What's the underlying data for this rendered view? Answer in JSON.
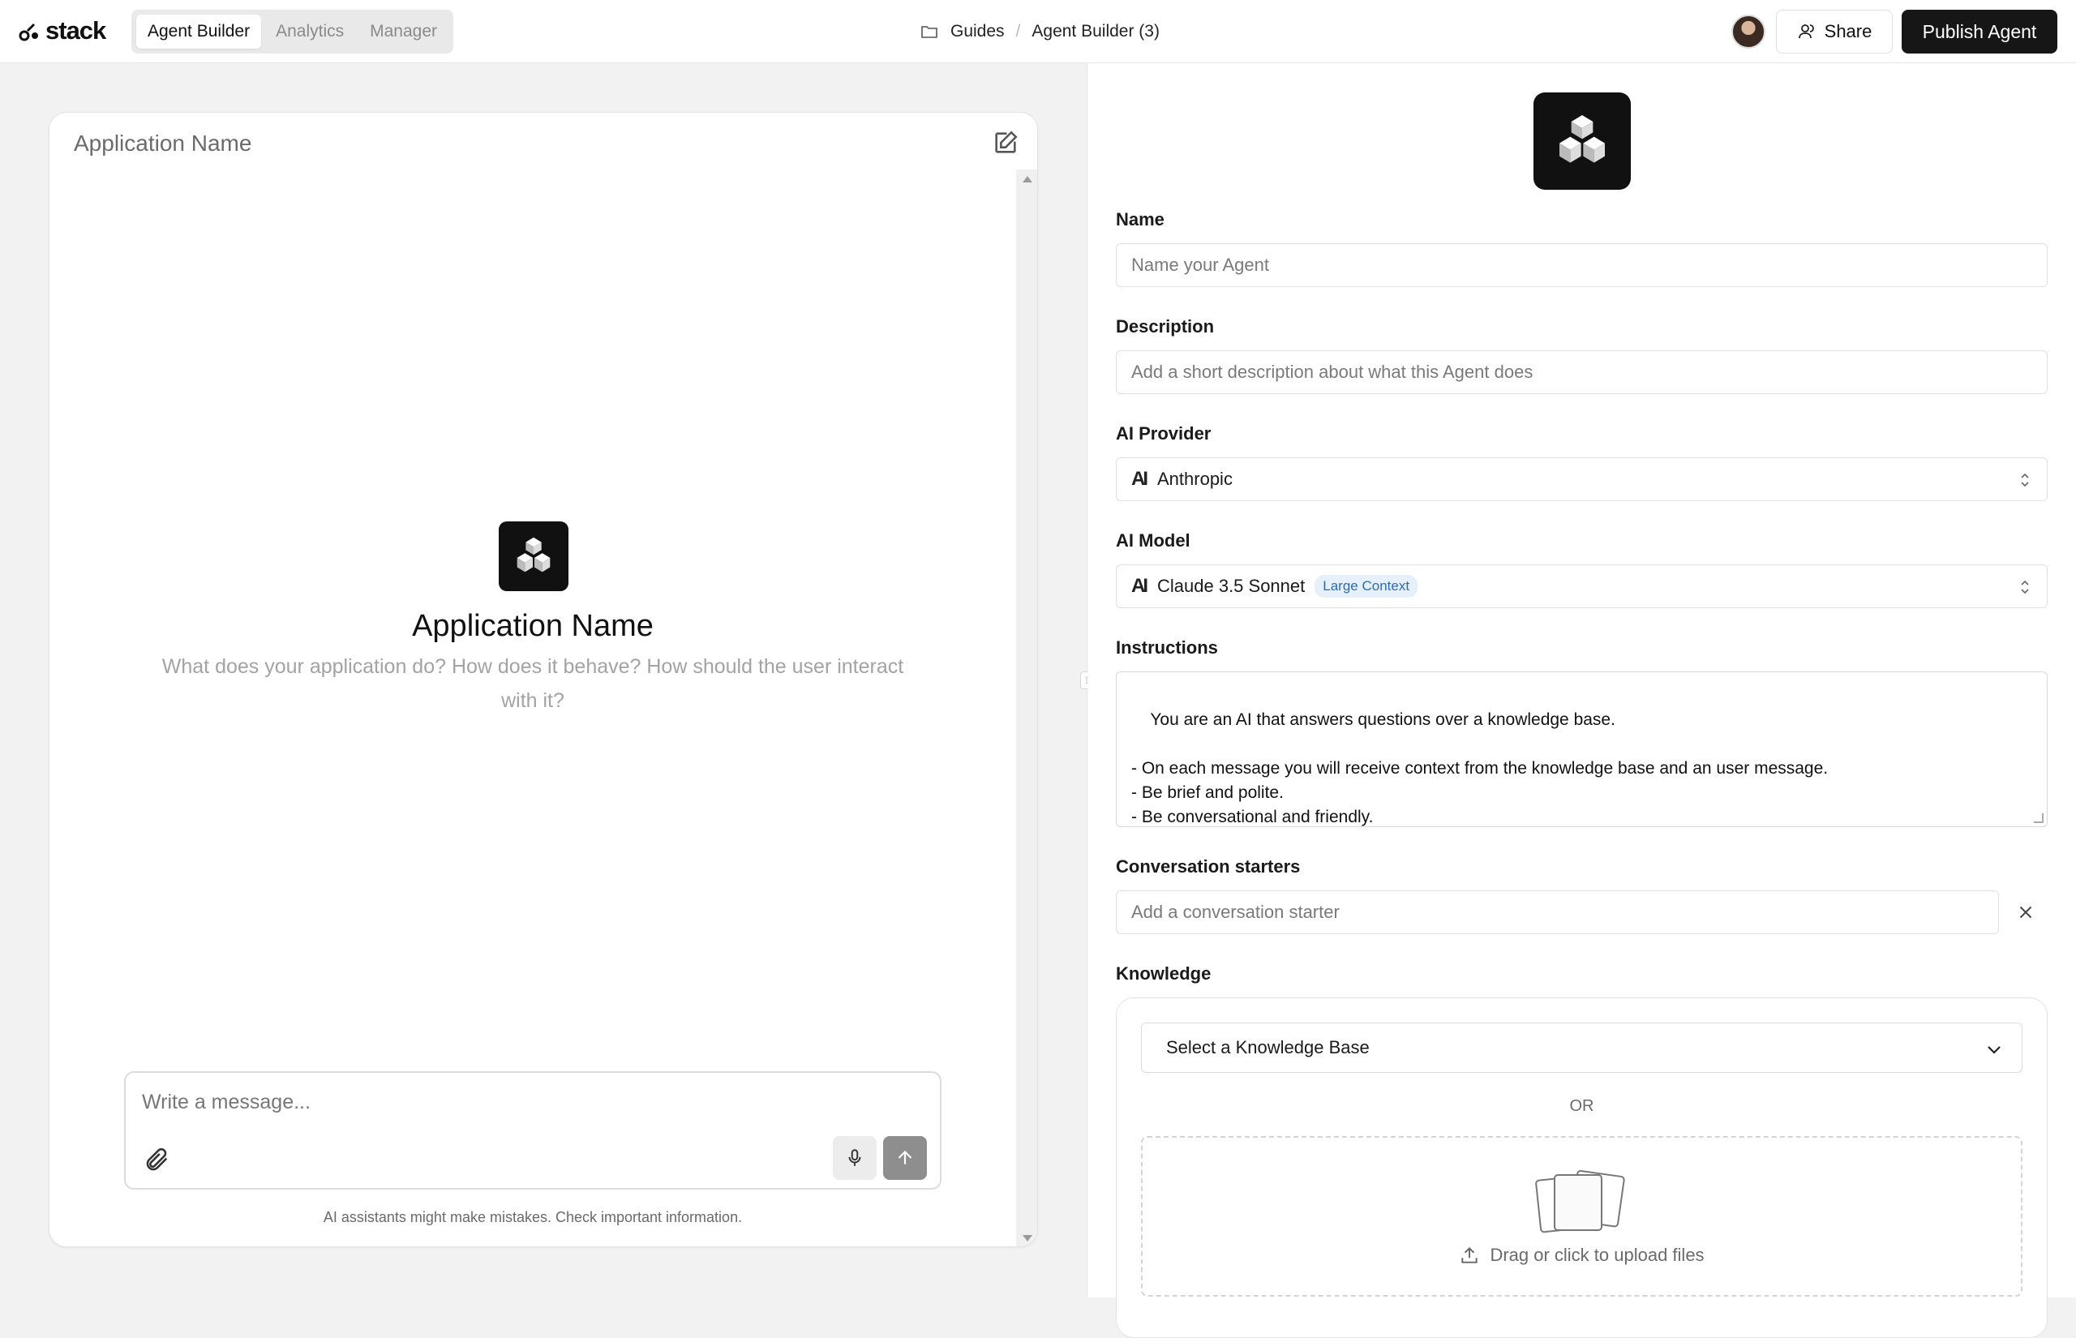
{
  "header": {
    "brand": "stack",
    "tabs": [
      {
        "label": "Agent Builder",
        "active": true
      },
      {
        "label": "Analytics",
        "active": false
      },
      {
        "label": "Manager",
        "active": false
      }
    ],
    "breadcrumb": {
      "folder": "Guides",
      "separator": "/",
      "current": "Agent Builder (3)"
    },
    "share_label": "Share",
    "publish_label": "Publish Agent"
  },
  "preview": {
    "title": "Application Name",
    "app_name": "Application Name",
    "app_description": "What does your application do? How does it behave? How should the user interact with it?",
    "composer_placeholder": "Write a message...",
    "disclaimer": "AI assistants might make mistakes. Check important information."
  },
  "form": {
    "name": {
      "label": "Name",
      "placeholder": "Name your Agent"
    },
    "description": {
      "label": "Description",
      "placeholder": "Add a short description about what this Agent does"
    },
    "provider": {
      "label": "AI Provider",
      "value": "Anthropic",
      "logo": "AI"
    },
    "model": {
      "label": "AI Model",
      "value": "Claude 3.5 Sonnet",
      "badge": "Large Context",
      "logo": "AI"
    },
    "instructions": {
      "label": "Instructions",
      "value": "You are an AI that answers questions over a knowledge base.\n\n- On each message you will receive context from the knowledge base and an user message.\n- Be brief and polite.\n- Be conversational and friendly."
    },
    "starters": {
      "label": "Conversation starters",
      "placeholder": "Add a conversation starter"
    },
    "knowledge": {
      "label": "Knowledge",
      "select_label": "Select a Knowledge Base",
      "or_label": "OR",
      "upload_label": "Drag or click to upload files"
    }
  },
  "colors": {
    "primary": "#161616",
    "badge_text": "#2b6cb0",
    "badge_bg": "#e6f0fb",
    "muted": "#a3a3a3"
  }
}
